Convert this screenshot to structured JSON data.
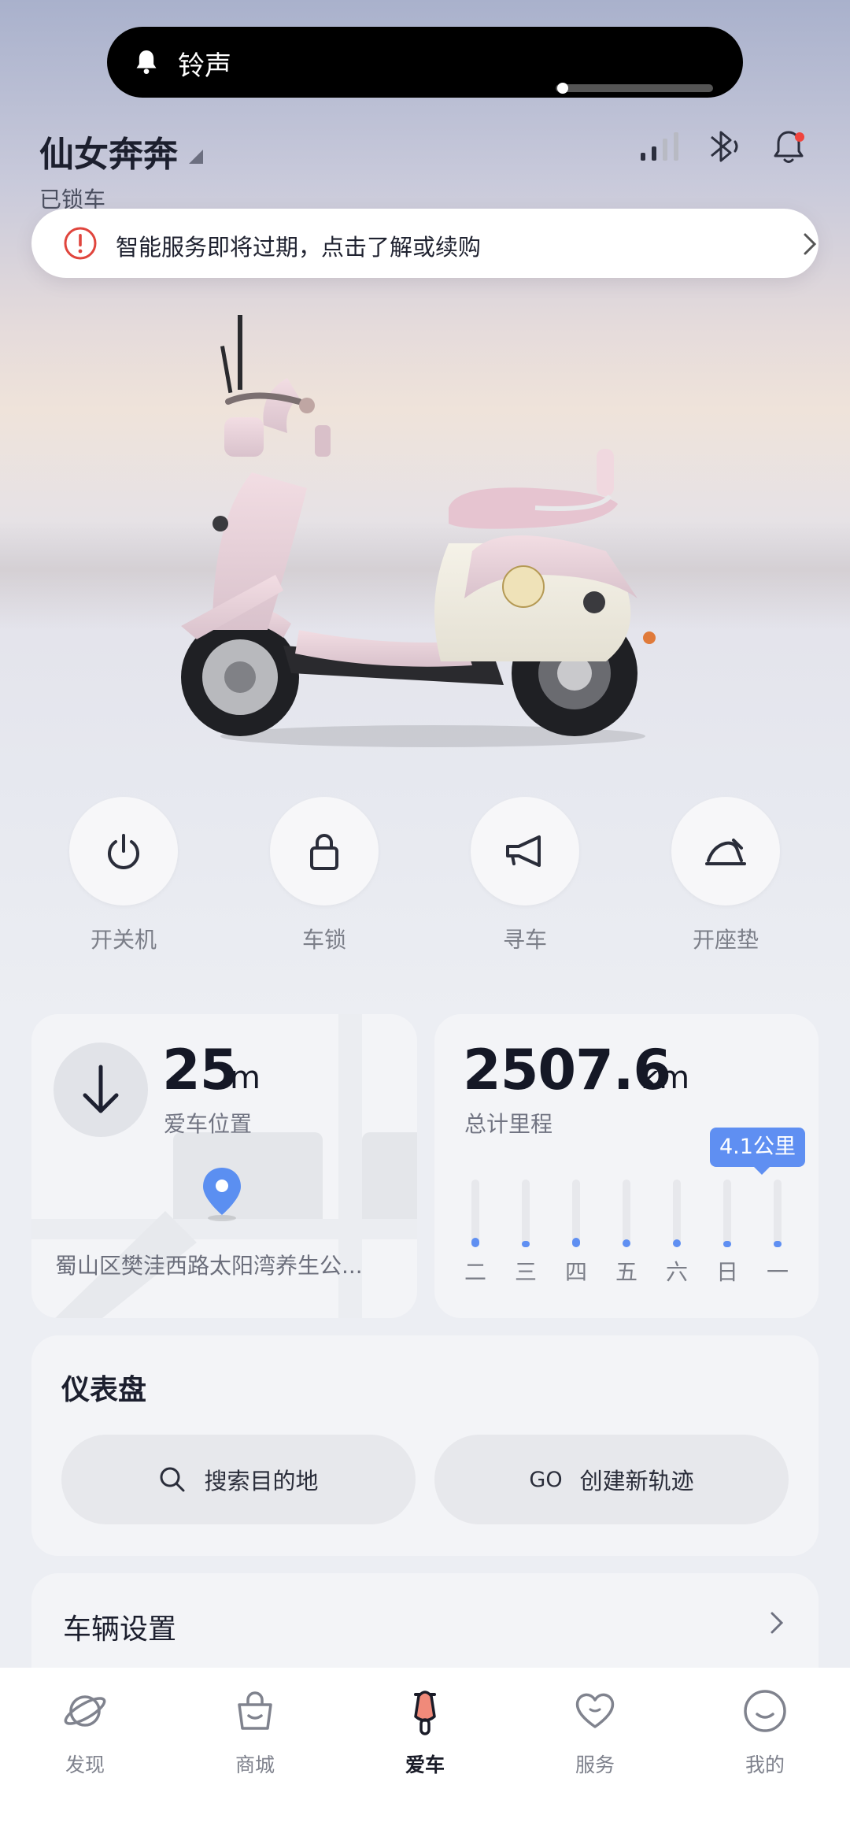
{
  "notification": {
    "label": "铃声",
    "volume": 0.02
  },
  "header": {
    "vehicle_name": "仙女奔奔",
    "status": "已锁车"
  },
  "banner": {
    "text": "智能服务即将过期，点击了解或续购"
  },
  "controls": [
    {
      "label": "开关机",
      "icon": "power-icon"
    },
    {
      "label": "车锁",
      "icon": "lock-icon"
    },
    {
      "label": "寻车",
      "icon": "horn-icon"
    },
    {
      "label": "开座垫",
      "icon": "seat-icon"
    }
  ],
  "location_card": {
    "distance": "25",
    "unit": "m",
    "label": "爱车位置",
    "address": "蜀山区樊洼西路太阳湾养生公..."
  },
  "mileage_card": {
    "total": "2507.6",
    "unit": "km",
    "label": "总计里程",
    "tooltip": "4.1公里",
    "days": [
      "二",
      "三",
      "四",
      "五",
      "六",
      "日",
      "一"
    ],
    "day_levels": [
      0.14,
      0.06,
      0.14,
      0.12,
      0.12,
      0.06,
      0.05
    ],
    "accent": "#5f8ff2"
  },
  "dashboard": {
    "title": "仪表盘",
    "search_label": "搜索目的地",
    "go_prefix": "GO",
    "track_label": "创建新轨迹"
  },
  "settings": {
    "title": "车辆设置"
  },
  "tabs": [
    {
      "label": "发现",
      "icon": "planet-icon"
    },
    {
      "label": "商城",
      "icon": "bag-icon"
    },
    {
      "label": "爱车",
      "icon": "scooter-icon",
      "active": true
    },
    {
      "label": "服务",
      "icon": "heart-icon"
    },
    {
      "label": "我的",
      "icon": "smile-icon"
    }
  ]
}
